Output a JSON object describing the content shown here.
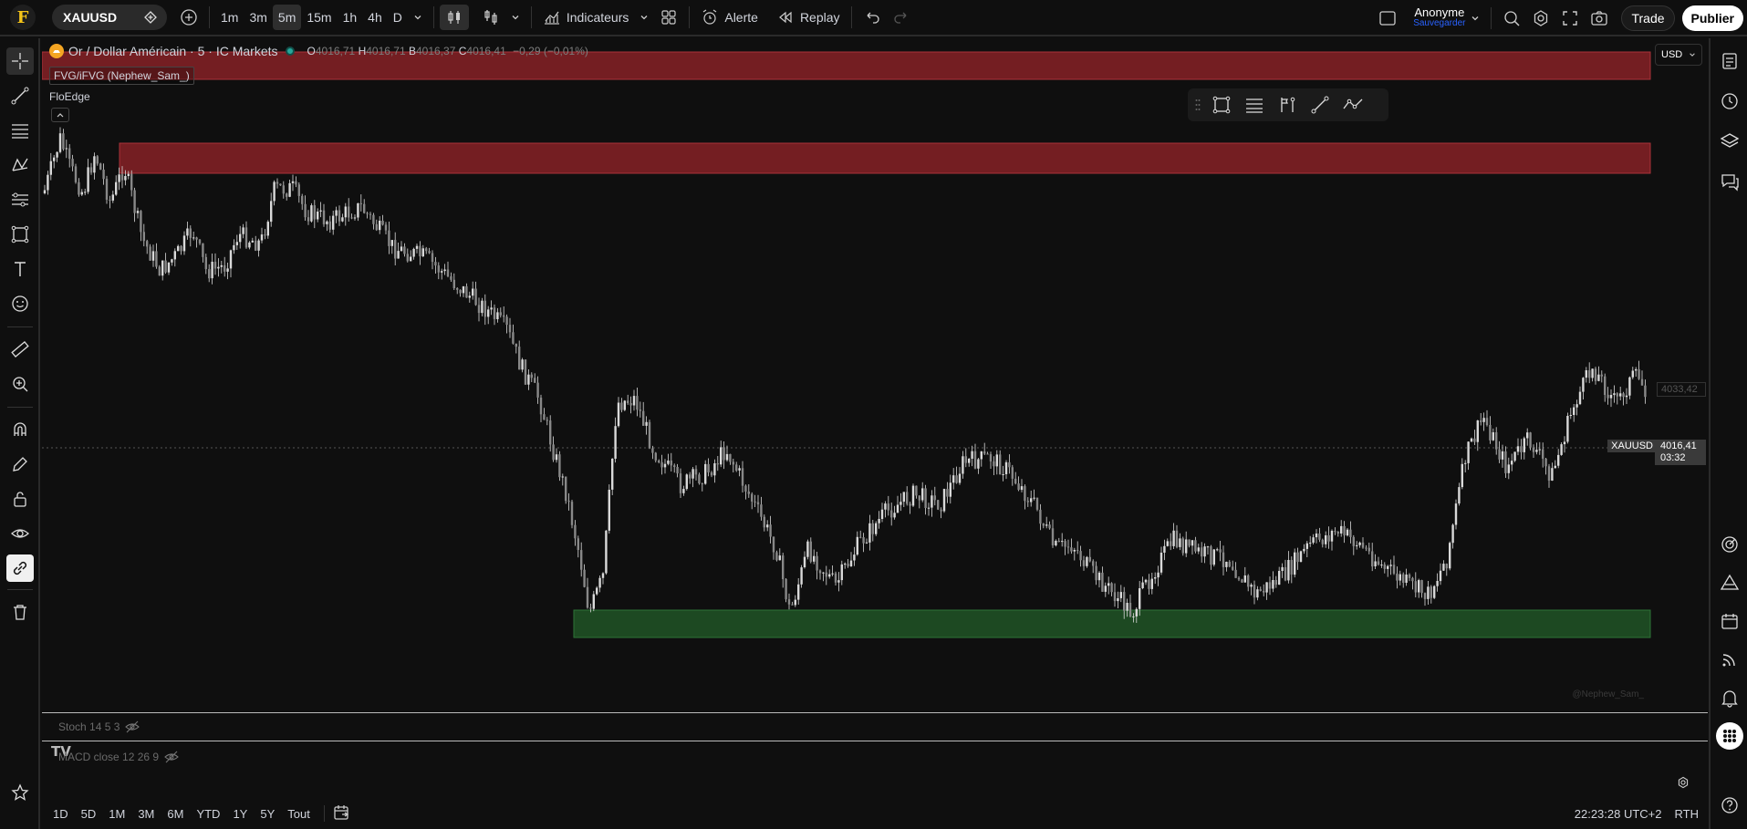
{
  "topbar": {
    "logo": "F",
    "symbol": "XAUUSD",
    "intervals": [
      "1m",
      "3m",
      "5m",
      "15m",
      "1h",
      "4h",
      "D"
    ],
    "active_interval": "5m",
    "indicators_label": "Indicateurs",
    "alert_label": "Alerte",
    "replay_label": "Replay",
    "user_name": "Anonyme",
    "user_sub": "Sauvegarder",
    "trade_label": "Trade",
    "publish_label": "Publier"
  },
  "chart": {
    "title": "Or / Dollar Américain · 5 · IC Markets",
    "ohlc": {
      "o_label": "O",
      "o": "4016,71",
      "h_label": "H",
      "h": "4016,71",
      "b_label": "B",
      "b": "4016,37",
      "c_label": "C",
      "c": "4016,41",
      "change": "−0,29 (−0,01%)"
    },
    "indicator_1": "FVG/iFVG (Nephew_Sam_)",
    "indicator_2": "FloEdge",
    "currency": "USD",
    "price_label_grey": "4033,42",
    "last_symbol": "XAUUSD",
    "last_price": "4016,41",
    "countdown": "03:32",
    "watermark": "@Nephew_Sam_",
    "colors": {
      "bear_zone": "#7a1f24",
      "bull_zone": "#1e4d24",
      "candle": "#d9d9d9",
      "background": "#0f0f0f"
    }
  },
  "chart_data": {
    "type": "candlestick",
    "title": "Or / Dollar Américain · 5 · IC Markets",
    "x": [],
    "series": [],
    "price_labels": [
      "4033,42",
      "4016,41"
    ]
  },
  "panes": {
    "stoch": "Stoch 14 5 3",
    "macd": "MACD close 12 26 9"
  },
  "bottombar": {
    "ranges": [
      "1D",
      "5D",
      "1M",
      "3M",
      "6M",
      "YTD",
      "1Y",
      "5Y",
      "Tout"
    ],
    "time": "22:23:28 UTC+2",
    "session": "RTH"
  }
}
